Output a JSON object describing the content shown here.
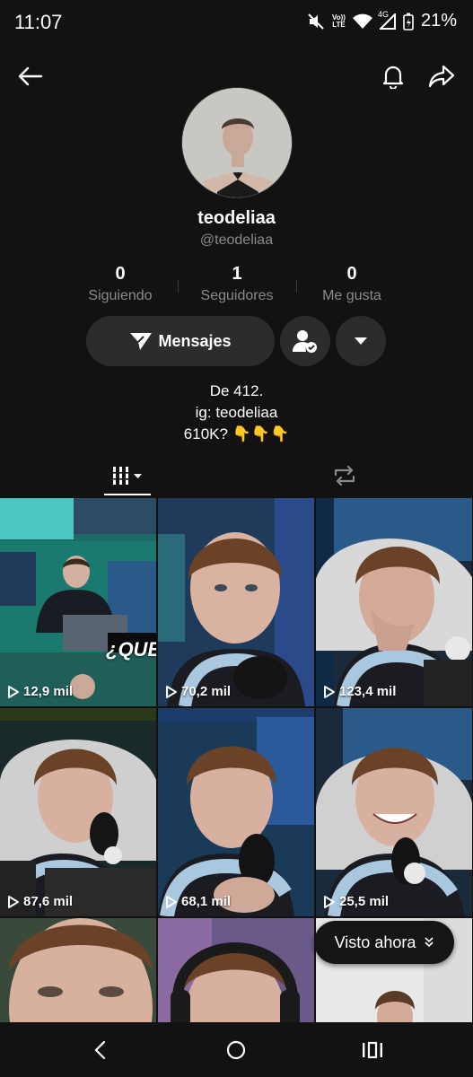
{
  "status_bar": {
    "time": "11:07",
    "volte_top": "Vo))",
    "volte_bottom": "LTE",
    "network": "4G",
    "battery": "21%"
  },
  "profile": {
    "display_name": "teodeliaa",
    "username": "@teodeliaa",
    "stats": [
      {
        "value": "0",
        "label": "Siguiendo"
      },
      {
        "value": "1",
        "label": "Seguidores"
      },
      {
        "value": "0",
        "label": "Me gusta"
      }
    ],
    "bio_lines": [
      "De 412.",
      "ig: teodeliaa",
      "610K? 👇👇👇"
    ]
  },
  "actions": {
    "message_label": "Mensajes"
  },
  "videos": [
    {
      "views": "12,9 mil",
      "overlay_text": "¿QUE"
    },
    {
      "views": "70,2 mil"
    },
    {
      "views": "123,4 mil"
    },
    {
      "views": "87,6 mil"
    },
    {
      "views": "68,1 mil"
    },
    {
      "views": "25,5 mil"
    },
    {
      "views": ""
    },
    {
      "views": ""
    },
    {
      "views": ""
    }
  ],
  "visto_ahora": "Visto ahora",
  "icons": [
    "back-arrow-icon",
    "bell-icon",
    "share-icon",
    "send-icon",
    "user-check-icon",
    "chevron-down-icon",
    "grid-icon",
    "repost-icon",
    "play-icon"
  ],
  "colors": {
    "background": "#121212",
    "button_bg": "#2c2c2c",
    "muted_text": "#8a8a8a"
  }
}
